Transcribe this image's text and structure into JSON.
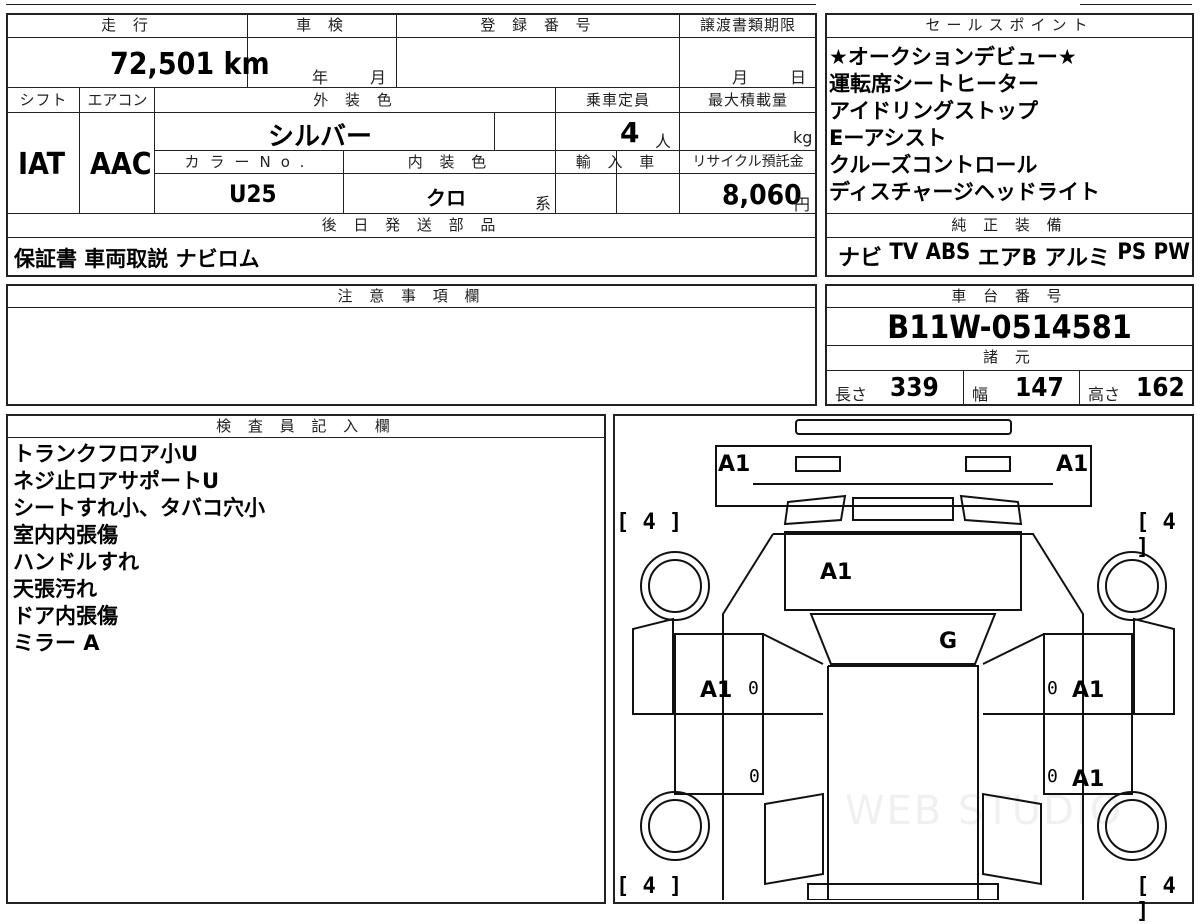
{
  "headers": {
    "mileage": "走 行",
    "inspection": "車 検",
    "registration": "登 録 番 号",
    "transfer_deadline": "譲渡書類期限",
    "sales_points": "セールスポイント",
    "shift": "シフト",
    "aircon": "エアコン",
    "exterior_color": "外 装 色",
    "capacity": "乗車定員",
    "max_load": "最大積載量",
    "color_no": "カラーNo.",
    "interior_color": "内 装 色",
    "import": "輸 入 車",
    "recycle": "リサイクル預託金",
    "later_parts": "後 日 発 送 部 品",
    "genuine_equipment": "純 正 装 備",
    "notes": "注 意 事 項 欄",
    "chassis_no": "車 台 番 号",
    "specs": "諸 元",
    "inspector": "検 査 員 記 入 欄"
  },
  "values": {
    "mileage": "72,501 km",
    "year_label": "年",
    "month_label": "月",
    "deadline_month": "月",
    "deadline_day": "日",
    "shift": "IAT",
    "aircon": "AAC",
    "exterior_color": "シルバー",
    "capacity": "4",
    "capacity_unit": "人",
    "load_unit": "kg",
    "color_no": "U25",
    "interior_color": "クロ",
    "interior_suffix": "系",
    "recycle_amount": "8,060",
    "recycle_unit": "円",
    "later_parts": "保証書 車両取説 ナビロム",
    "chassis_no": "B11W-0514581"
  },
  "sales_points": [
    "★オークションデビュー★",
    "運転席シートヒーター",
    "アイドリングストップ",
    "Eーアシスト",
    "クルーズコントロール",
    "ディスチャージヘッドライト"
  ],
  "genuine_equipment": [
    "ナビ",
    "TV",
    "ABS",
    "エアB",
    "アルミ",
    "PS",
    "PW"
  ],
  "specs": {
    "length_label": "長さ",
    "length": "339",
    "width_label": "幅",
    "width": "147",
    "height_label": "高さ",
    "height": "162"
  },
  "inspector_notes": [
    "トランクフロア小U",
    "ネジ止ロアサポートU",
    "シートすれ小、タバコ穴小",
    "室内内張傷",
    "ハンドルすれ",
    "天張汚れ",
    "ドア内張傷",
    "ミラー A"
  ],
  "diagram": {
    "marks": {
      "front_left": "A1",
      "front_right": "A1",
      "hood": "A1",
      "windshield": "G",
      "front_door_left": "A1",
      "front_door_right": "A1",
      "rear_door_right": "A1"
    },
    "tires": {
      "front_left": "4",
      "front_right": "4",
      "rear_left": "4",
      "rear_right": "4"
    },
    "zero": "0",
    "watermark": "WEB STUDIO"
  }
}
